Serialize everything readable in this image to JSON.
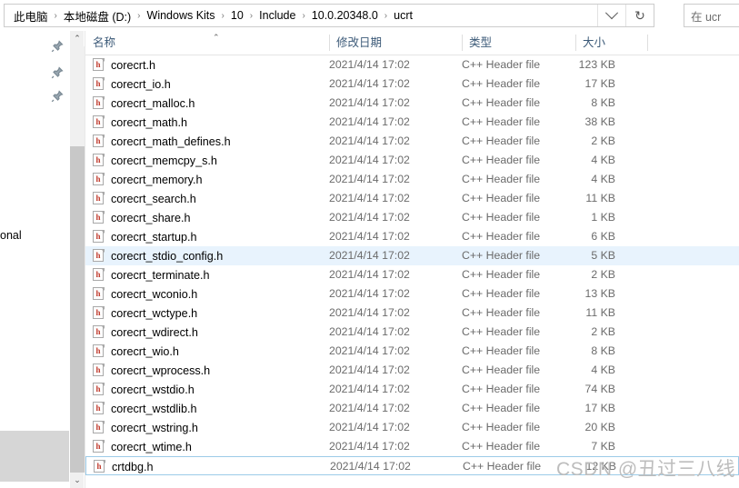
{
  "addressbar": {
    "breadcrumbs": [
      {
        "label": "此电脑"
      },
      {
        "label": "本地磁盘 (D:)"
      },
      {
        "label": "Windows Kits"
      },
      {
        "label": "10"
      },
      {
        "label": "Include"
      },
      {
        "label": "10.0.20348.0"
      },
      {
        "label": "ucrt"
      }
    ],
    "separator": "›",
    "dropdown_icon": "chevron-down-icon",
    "refresh_icon": "refresh-icon",
    "refresh_glyph": "↻"
  },
  "search": {
    "value": "在 ucr",
    "placeholder": "在 ucrt 中搜索"
  },
  "navpane": {
    "pins": [
      "pin-icon",
      "pin-icon",
      "pin-icon"
    ],
    "truncated_label": "onal",
    "scroll_up_glyph": "⌃",
    "scroll_down_glyph": "⌄"
  },
  "columns": {
    "name": "名称",
    "date_modified": "修改日期",
    "type": "类型",
    "size": "大小",
    "sort_indicator": "⌃"
  },
  "files": [
    {
      "name": "corecrt.h",
      "date": "2021/4/14 17:02",
      "type": "C++ Header file",
      "size": "123 KB",
      "state": "normal"
    },
    {
      "name": "corecrt_io.h",
      "date": "2021/4/14 17:02",
      "type": "C++ Header file",
      "size": "17 KB",
      "state": "normal"
    },
    {
      "name": "corecrt_malloc.h",
      "date": "2021/4/14 17:02",
      "type": "C++ Header file",
      "size": "8 KB",
      "state": "normal"
    },
    {
      "name": "corecrt_math.h",
      "date": "2021/4/14 17:02",
      "type": "C++ Header file",
      "size": "38 KB",
      "state": "normal"
    },
    {
      "name": "corecrt_math_defines.h",
      "date": "2021/4/14 17:02",
      "type": "C++ Header file",
      "size": "2 KB",
      "state": "normal"
    },
    {
      "name": "corecrt_memcpy_s.h",
      "date": "2021/4/14 17:02",
      "type": "C++ Header file",
      "size": "4 KB",
      "state": "normal"
    },
    {
      "name": "corecrt_memory.h",
      "date": "2021/4/14 17:02",
      "type": "C++ Header file",
      "size": "4 KB",
      "state": "normal"
    },
    {
      "name": "corecrt_search.h",
      "date": "2021/4/14 17:02",
      "type": "C++ Header file",
      "size": "11 KB",
      "state": "normal"
    },
    {
      "name": "corecrt_share.h",
      "date": "2021/4/14 17:02",
      "type": "C++ Header file",
      "size": "1 KB",
      "state": "normal"
    },
    {
      "name": "corecrt_startup.h",
      "date": "2021/4/14 17:02",
      "type": "C++ Header file",
      "size": "6 KB",
      "state": "normal"
    },
    {
      "name": "corecrt_stdio_config.h",
      "date": "2021/4/14 17:02",
      "type": "C++ Header file",
      "size": "5 KB",
      "state": "selected"
    },
    {
      "name": "corecrt_terminate.h",
      "date": "2021/4/14 17:02",
      "type": "C++ Header file",
      "size": "2 KB",
      "state": "normal"
    },
    {
      "name": "corecrt_wconio.h",
      "date": "2021/4/14 17:02",
      "type": "C++ Header file",
      "size": "13 KB",
      "state": "normal"
    },
    {
      "name": "corecrt_wctype.h",
      "date": "2021/4/14 17:02",
      "type": "C++ Header file",
      "size": "11 KB",
      "state": "normal"
    },
    {
      "name": "corecrt_wdirect.h",
      "date": "2021/4/14 17:02",
      "type": "C++ Header file",
      "size": "2 KB",
      "state": "normal"
    },
    {
      "name": "corecrt_wio.h",
      "date": "2021/4/14 17:02",
      "type": "C++ Header file",
      "size": "8 KB",
      "state": "normal"
    },
    {
      "name": "corecrt_wprocess.h",
      "date": "2021/4/14 17:02",
      "type": "C++ Header file",
      "size": "4 KB",
      "state": "normal"
    },
    {
      "name": "corecrt_wstdio.h",
      "date": "2021/4/14 17:02",
      "type": "C++ Header file",
      "size": "74 KB",
      "state": "normal"
    },
    {
      "name": "corecrt_wstdlib.h",
      "date": "2021/4/14 17:02",
      "type": "C++ Header file",
      "size": "17 KB",
      "state": "normal"
    },
    {
      "name": "corecrt_wstring.h",
      "date": "2021/4/14 17:02",
      "type": "C++ Header file",
      "size": "20 KB",
      "state": "normal"
    },
    {
      "name": "corecrt_wtime.h",
      "date": "2021/4/14 17:02",
      "type": "C++ Header file",
      "size": "7 KB",
      "state": "normal"
    },
    {
      "name": "crtdbg.h",
      "date": "2021/4/14 17:02",
      "type": "C++ Header file",
      "size": "12 KB",
      "state": "focused"
    }
  ],
  "file_icon": {
    "name": "h-header-file-icon",
    "letter": "h"
  },
  "watermark": {
    "text": "CSDN @丑过三八线"
  },
  "colors": {
    "selection": "#e8f3fd",
    "focus_border": "#9ccbe8",
    "header_text": "#3c5a78",
    "secondary_text": "#6b6b6b",
    "icon_letter": "#c0392b",
    "watermark": "#bdbdbd"
  }
}
